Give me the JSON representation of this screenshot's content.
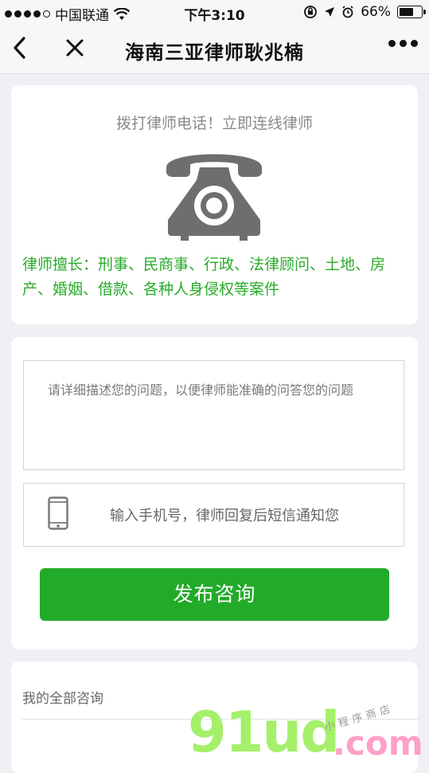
{
  "status_bar": {
    "carrier": "中国联通",
    "time": "下午3:10",
    "battery": "66%",
    "battery_level": 0.66
  },
  "nav": {
    "title": "海南三亚律师耿兆楠",
    "back_icon": "chevron-left-icon",
    "close_icon": "close-icon",
    "more_icon": "more-dots-icon"
  },
  "call_card": {
    "prompt": "拨打律师电话！立即连线律师",
    "icon": "telephone-icon",
    "specialty": "律师擅长：刑事、民商事、行政、法律顾问、土地、房产、婚姻、借款、各种人身侵权等案件"
  },
  "form": {
    "question_placeholder": "请详细描述您的问题，以便律师能准确的问答您的问题",
    "phone_icon": "mobile-phone-icon",
    "phone_placeholder": "输入手机号，律师回复后短信通知您",
    "submit_label": "发布咨询"
  },
  "history": {
    "label": "我的全部咨询"
  },
  "watermark": {
    "main": "91ud",
    "suffix": ".com",
    "tagline": "小程序商店"
  },
  "colors": {
    "accent_green": "#22aa29",
    "specialty_text": "#2aab2a",
    "background": "#efeff4"
  }
}
